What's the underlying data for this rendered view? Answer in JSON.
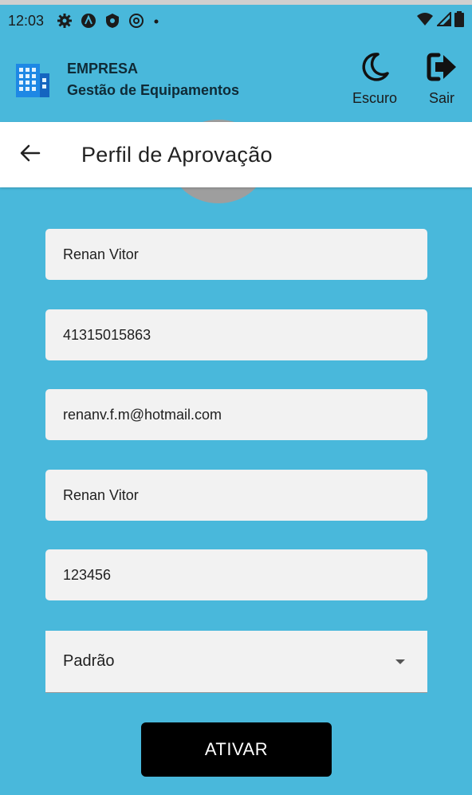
{
  "status_bar": {
    "time": "12:03",
    "left_icons": [
      "gear-icon",
      "autocomplete-icon",
      "shield-icon",
      "at-icon",
      "dot-icon"
    ],
    "right_icons": [
      "wifi-icon",
      "signal-icon",
      "battery-icon"
    ]
  },
  "app_bar": {
    "company": "EMPRESA",
    "subtitle": "Gestão de Equipamentos",
    "dark_mode_label": "Escuro",
    "exit_label": "Sair"
  },
  "page": {
    "title": "Perfil de Aprovação"
  },
  "form": {
    "name": "Renan Vitor",
    "phone": "41315015863",
    "email": "renanv.f.m@hotmail.com",
    "username": "Renan Vitor",
    "password": "123456",
    "profile_select": "Padrão"
  },
  "actions": {
    "activate_label": "ATIVAR"
  },
  "colors": {
    "background": "#49B8DB",
    "field": "#F2F2F2",
    "button": "#000000"
  }
}
